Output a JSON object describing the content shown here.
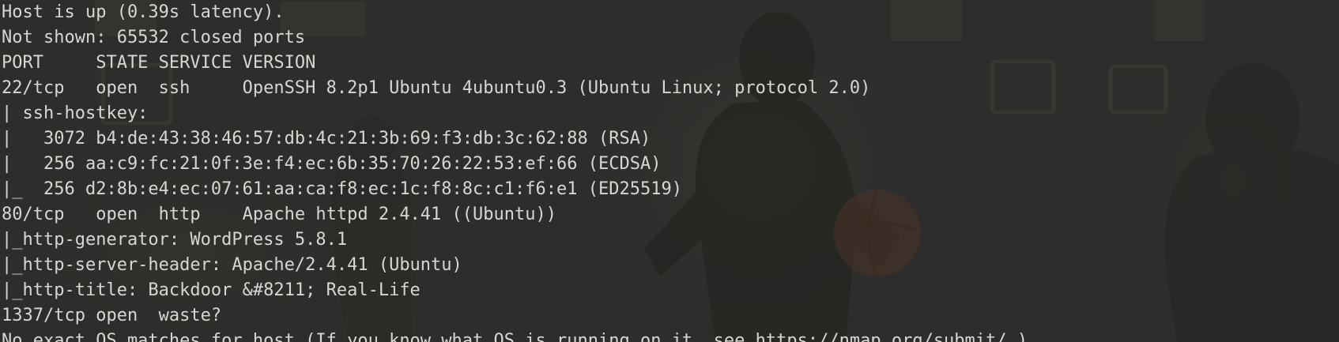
{
  "terminal": {
    "background_color": "#2e2e2c",
    "text_color": "#d7d7d2",
    "lines": [
      "Host is up (0.39s latency).",
      "Not shown: 65532 closed ports",
      "PORT     STATE SERVICE VERSION",
      "22/tcp   open  ssh     OpenSSH 8.2p1 Ubuntu 4ubuntu0.3 (Ubuntu Linux; protocol 2.0)",
      "| ssh-hostkey:",
      "|   3072 b4:de:43:38:46:57:db:4c:21:3b:69:f3:db:3c:62:88 (RSA)",
      "|   256 aa:c9:fc:21:0f:3e:f4:ec:6b:35:70:26:22:53:ef:66 (ECDSA)",
      "|_  256 d2:8b:e4:ec:07:61:aa:ca:f8:ec:1c:f8:8c:c1:f6:e1 (ED25519)",
      "80/tcp   open  http    Apache httpd 2.4.41 ((Ubuntu))",
      "|_http-generator: WordPress 5.8.1",
      "|_http-server-header: Apache/2.4.41 (Ubuntu)",
      "|_http-title: Backdoor &#8211; Real-Life",
      "1337/tcp open  waste?",
      "No exact OS matches for host (If you know what OS is running on it, see https://nmap.org/submit/ )."
    ]
  }
}
